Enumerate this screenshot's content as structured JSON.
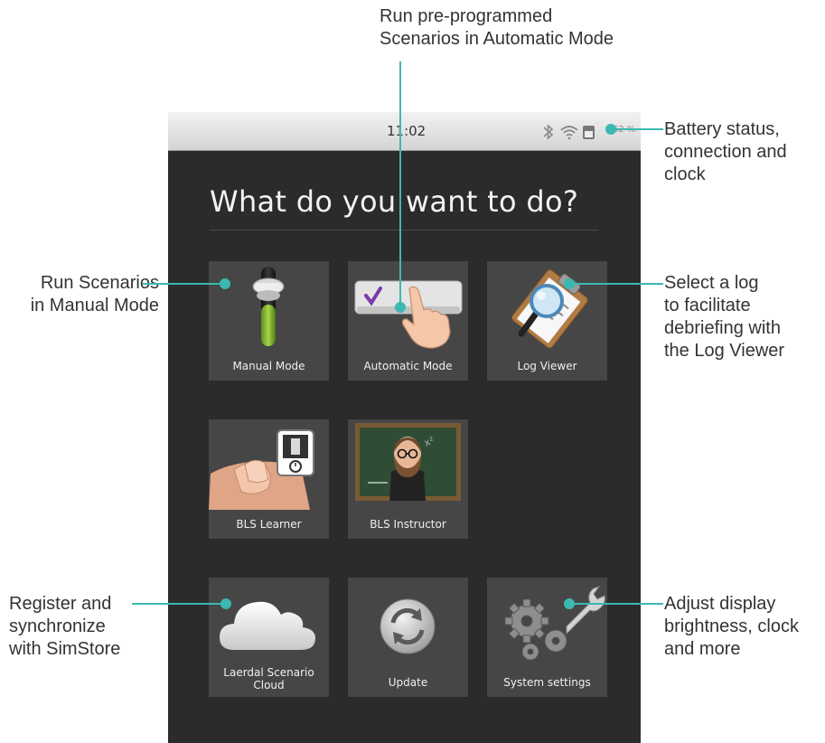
{
  "status_bar": {
    "time": "11:02",
    "battery_percent": "62 %",
    "icons": [
      "bluetooth-icon",
      "wifi-icon",
      "battery-icon"
    ]
  },
  "screen": {
    "heading": "What do you want to do?"
  },
  "tiles": [
    {
      "label": "Manual Mode",
      "icon": "manual-switch-icon"
    },
    {
      "label": "Automatic Mode",
      "icon": "automatic-check-hand-icon"
    },
    {
      "label": "Log Viewer",
      "icon": "clipboard-magnifier-icon"
    },
    {
      "label": "BLS Learner",
      "icon": "cpr-hands-timer-icon"
    },
    {
      "label": "BLS Instructor",
      "icon": "instructor-chalkboard-icon"
    },
    {
      "label": "Laerdal Scenario Cloud",
      "icon": "cloud-icon"
    },
    {
      "label": "Update",
      "icon": "refresh-icon"
    },
    {
      "label": "System settings",
      "icon": "gears-wrench-icon"
    }
  ],
  "callouts": {
    "automatic": [
      "Run pre-programmed",
      "Scenarios in Automatic Mode"
    ],
    "battery": [
      "Battery status,",
      "connection and",
      "clock"
    ],
    "manual": [
      "Run Scenarios",
      "in Manual Mode"
    ],
    "log": [
      "Select a log",
      "to facilitate",
      "debriefing with",
      "the Log Viewer"
    ],
    "cloud": [
      "Register and",
      "synchronize",
      "with SimStore"
    ],
    "settings": [
      "Adjust display",
      "brightness, clock",
      "and more"
    ]
  },
  "colors": {
    "leader_line": "#3cb8b2",
    "screen_background": "#2b2b2b",
    "tile_background": "#464646"
  }
}
